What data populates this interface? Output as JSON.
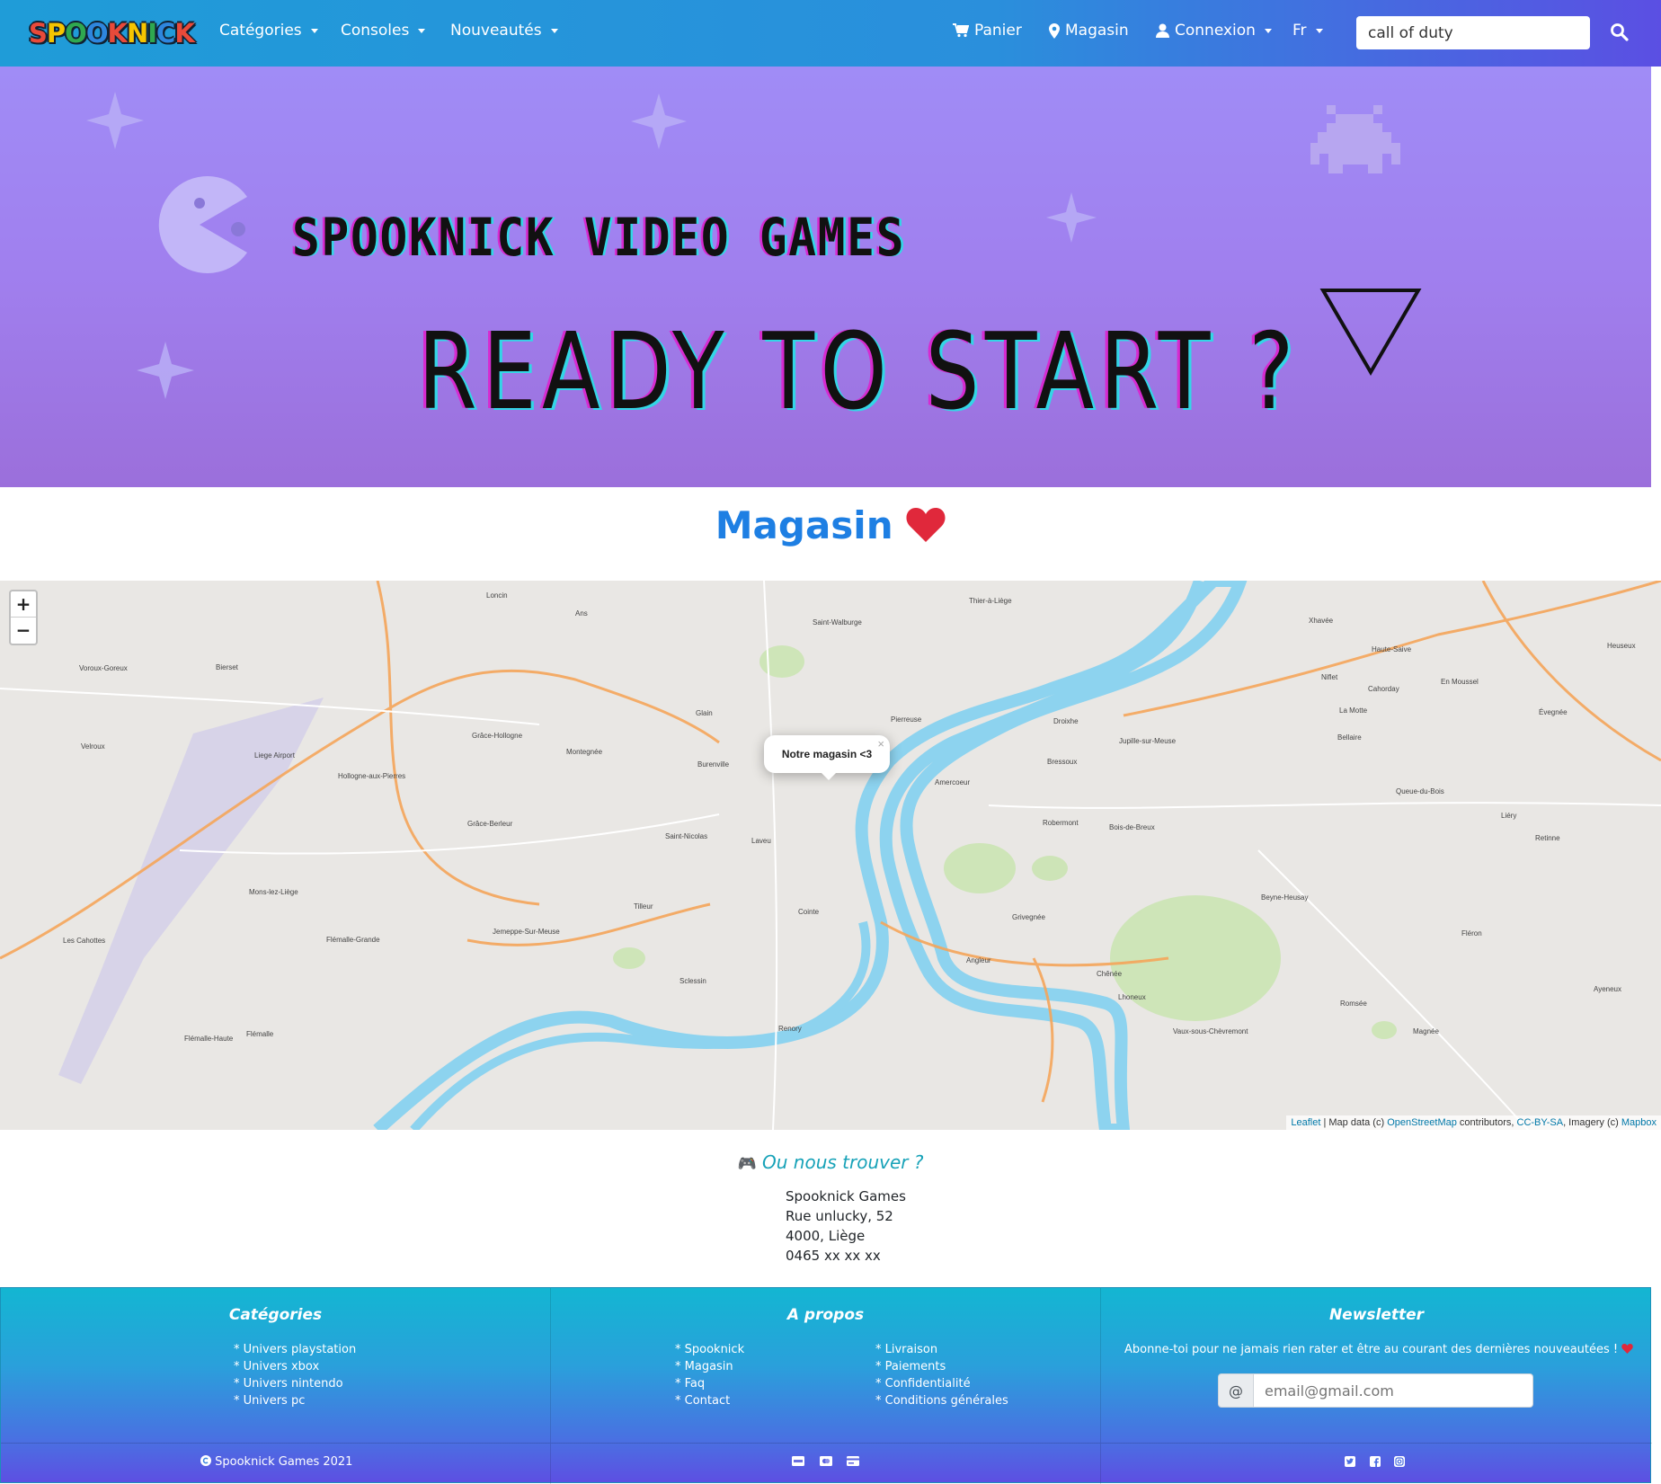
{
  "brand": {
    "logo_text": "SPOOKNICK",
    "logo_colors": [
      "#e84a3a",
      "#f5c400",
      "#2fa84f",
      "#2e86de",
      "#e84a3a",
      "#f5c400",
      "#2fa84f",
      "#2e86de",
      "#e84a3a"
    ]
  },
  "nav": {
    "categories": "Catégories",
    "consoles": "Consoles",
    "news": "Nouveautés",
    "cart": "Panier",
    "store": "Magasin",
    "login": "Connexion",
    "lang": "Fr",
    "search_value": "call of duty"
  },
  "banner": {
    "title": "SPOOKNICK VIDEO GAMES",
    "subtitle": "READY TO START ?"
  },
  "store": {
    "heading": "Magasin"
  },
  "map": {
    "zoom_in": "+",
    "zoom_out": "−",
    "popup_text": "Notre magasin <3",
    "popup_close": "×",
    "attribution": {
      "leaflet": "Leaflet",
      "sep1": " | Map data (c) ",
      "osm": "OpenStreetMap",
      "sep2": " contributors, ",
      "license": "CC-BY-SA",
      "sep3": ", Imagery (c) ",
      "mapbox": "Mapbox"
    },
    "labels": [
      {
        "text": "Loncin"
      },
      {
        "text": "Ans"
      },
      {
        "text": "Bierset"
      },
      {
        "text": "Voroux-Goreux"
      },
      {
        "text": "Grâce-Hollogne"
      },
      {
        "text": "Montegnée"
      },
      {
        "text": "Liege Airport"
      },
      {
        "text": "Velroux"
      },
      {
        "text": "Hollogne-aux-Pierres"
      },
      {
        "text": "Saint-Nicolas"
      },
      {
        "text": "Grâce-Berleur"
      },
      {
        "text": "Mons-lez-Liège"
      },
      {
        "text": "Tilleur"
      },
      {
        "text": "Jemeppe-Sur-Meuse"
      },
      {
        "text": "Flémalle-Grande"
      },
      {
        "text": "Les Cahottes"
      },
      {
        "text": "Flémalle"
      },
      {
        "text": "Flémalle-Haute"
      },
      {
        "text": "Xhavée"
      },
      {
        "text": "Haute-Saive"
      },
      {
        "text": "En Moussel"
      },
      {
        "text": "Cahorday"
      },
      {
        "text": "Heuseux"
      },
      {
        "text": "Niflet"
      },
      {
        "text": "La Motte"
      },
      {
        "text": "Bellaire"
      },
      {
        "text": "Évegnée"
      },
      {
        "text": "Queue-du-Bois"
      },
      {
        "text": "Liéry"
      },
      {
        "text": "Retinne"
      },
      {
        "text": "Beyne-Heusay"
      },
      {
        "text": "Fléron"
      },
      {
        "text": "Ayeneux"
      },
      {
        "text": "Romsée"
      },
      {
        "text": "Magnée"
      },
      {
        "text": "Lhoneux"
      },
      {
        "text": "Chênée"
      },
      {
        "text": "Angleur"
      },
      {
        "text": "Cointe"
      },
      {
        "text": "Sclessin"
      },
      {
        "text": "Burenville"
      },
      {
        "text": "Glain"
      },
      {
        "text": "Saint-Laurent"
      },
      {
        "text": "Laveu"
      },
      {
        "text": "Pierreuse"
      },
      {
        "text": "Bressoux"
      },
      {
        "text": "Jupille-sur-Meuse"
      },
      {
        "text": "Droixhe"
      },
      {
        "text": "Amercoeur"
      },
      {
        "text": "Grivegnée"
      },
      {
        "text": "Bois-de-Breux"
      },
      {
        "text": "Saint-Walburge"
      },
      {
        "text": "Thier-à-Liège"
      },
      {
        "text": "Vaux-sous-Chèvremont"
      },
      {
        "text": "Robermont"
      },
      {
        "text": "Renory"
      }
    ]
  },
  "where": {
    "icon": "🎮",
    "title": "Ou nous trouver ?",
    "address": [
      "Spooknick Games",
      "Rue unlucky, 52",
      "4000, Liège",
      "0465 xx xx xx"
    ]
  },
  "footer": {
    "col1": {
      "title": "Catégories",
      "links": [
        "* Univers playstation",
        "* Univers xbox",
        "* Univers nintendo",
        "* Univers pc"
      ]
    },
    "col2": {
      "title": "A propos",
      "links_left": [
        "* Spooknick",
        "* Magasin",
        "* Faq",
        "* Contact"
      ],
      "links_right": [
        "* Livraison",
        "* Paiements",
        "* Confidentialité",
        "* Conditions générales"
      ]
    },
    "col3": {
      "title": "Newsletter",
      "text": "Abonne-toi pour ne jamais rien rater et être au courant des dernières nouveautées !",
      "at": "@",
      "placeholder": "email@gmail.com"
    },
    "copyright": "Spooknick Games 2021",
    "payment_icons": [
      "visa-icon",
      "mastercard-icon",
      "credit-card-icon"
    ],
    "social_icons": [
      "twitter-icon",
      "facebook-icon",
      "instagram-icon"
    ]
  },
  "colors": {
    "accent": "#1e7fe3",
    "teal": "#17a2b8",
    "heart": "#e0283b",
    "marker": "#d9352b"
  }
}
